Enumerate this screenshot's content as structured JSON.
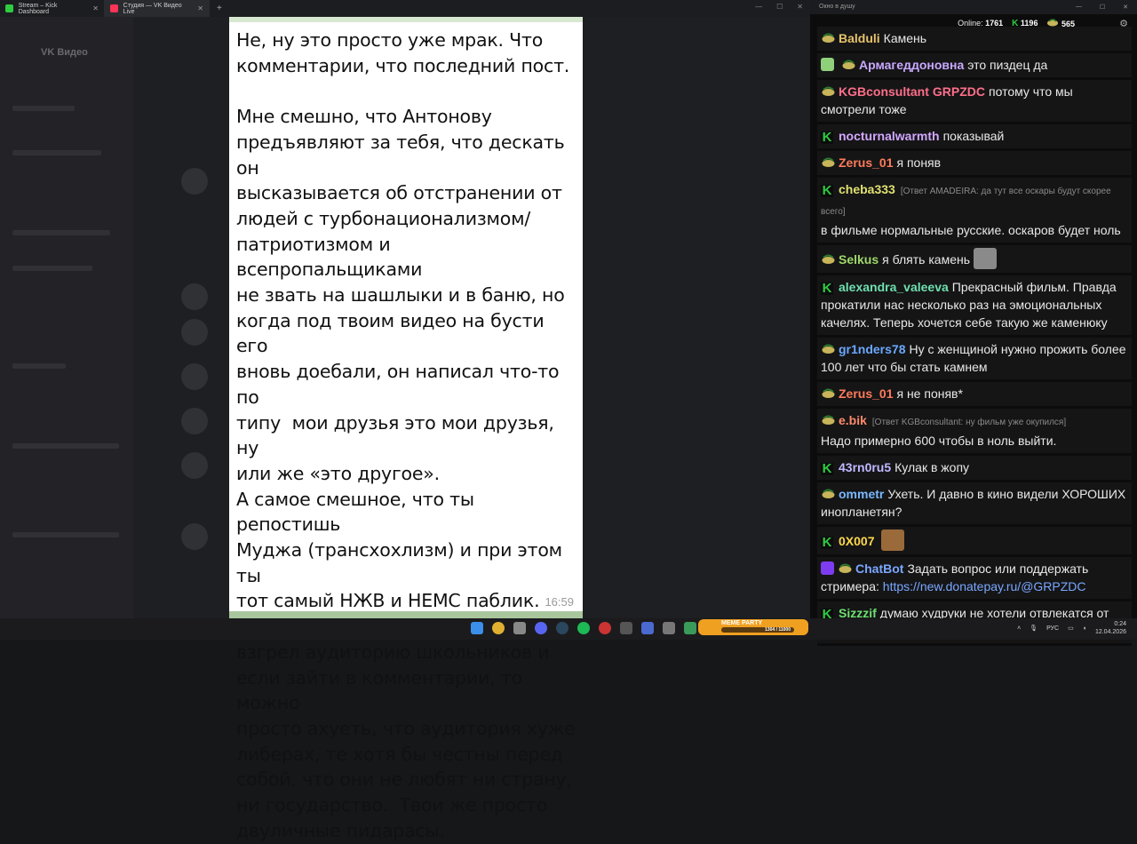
{
  "browser": {
    "tabs": [
      {
        "label": "Stream – Kick Dashboard",
        "color": "#2ecc40"
      },
      {
        "label": "Студия — VK Видео Live",
        "color": "#ff3355"
      }
    ],
    "new_tab": "+"
  },
  "background_app": {
    "title": "VK Видео"
  },
  "document": {
    "text": "Не, ну это просто уже мрак. Что\nкомментарии, что последний пост.\n\nМне смешно, что Антонову\nпредъявляют за тебя, что дескать он\nвысказывается об отстранении от\nлюдей с турбонационализмом/\nпатриотизмом и всепропальщиками\nне звать на шашлыки и в баню, но\nкогда под твоим видео на бусти его\nвновь доебали, он написал что-то по\nтипу  мои друзья это мои друзья, ну\nили же «это другое».\nА самое смешное, что ты репостишь\nМуджа (трансхохлизм) и при этом ты\nтот самый НЖВ и НЕМС паблик.  Ты\nвзгрел аудиторию школьников и\nесли зайти в комментарии, то можно\nпросто ахуеть, что аудитория хуже\nлиберах, те хотя бы честны перед\nсобой, что они не любят ни страну,\nни государство.  Твои же просто\nдвуличные пидарасы.",
    "time": "16:59"
  },
  "chat_window": {
    "title": "Окно в душу",
    "online_label": "Online:",
    "online_count": "1761",
    "kick_count": "1196",
    "vk_count": "565",
    "messages": [
      {
        "badge": "chip",
        "name": "Balduli",
        "color": "#e6c36a",
        "text": "Камень"
      },
      {
        "badge": "shield",
        "name": "Армагеддоновна",
        "color": "#c9a8ff",
        "text": "это пиздец да"
      },
      {
        "badge": "chip",
        "name": "KGBconsultant",
        "color": "#ff6f8a",
        "mention": "GRPZDC",
        "text": "потому что мы смотрели тоже"
      },
      {
        "badge": "k",
        "name": "nocturnalwarmth",
        "color": "#d2a8ff",
        "text": "показывай"
      },
      {
        "badge": "chip",
        "name": "Zerus_01",
        "color": "#ff7b5a",
        "text": "я поняв"
      },
      {
        "badge": "k",
        "name": "cheba333",
        "color": "#e0e070",
        "reply": "[Ответ AMADEIRA: да тут все оскары будут скорее всего]",
        "text": "в фильме нормальные русские. оскаров будет ноль"
      },
      {
        "badge": "chip",
        "name": "Selkus",
        "color": "#9fd86a",
        "text": "я блять камень",
        "emote": true
      },
      {
        "badge": "k",
        "name": "alexandra_valeeva",
        "color": "#6ee0b0",
        "text": "Прекрасный фильм. Правда прокатили нас несколько раз на эмоциональных качелях. Теперь хочется себе такую же каменюку"
      },
      {
        "badge": "chip",
        "name": "gr1nders78",
        "color": "#6aa8ff",
        "text": "Ну с женщиной нужно прожить более 100 лет что бы стать камнем"
      },
      {
        "badge": "chip",
        "name": "Zerus_01",
        "color": "#ff7b5a",
        "text": "я не поняв*"
      },
      {
        "badge": "chip",
        "name": "e.bik",
        "color": "#ff8a6a",
        "reply": "[Ответ KGBconsultant: ну фильм уже окупился]",
        "text": "Надо примерно 600 чтобы в ноль выйти."
      },
      {
        "badge": "k",
        "name": "43rn0ru5",
        "color": "#c0b8ff",
        "text": "Кулак в жопу"
      },
      {
        "badge": "chip",
        "name": "ommetr",
        "color": "#7ab8ff",
        "text": "Ухеть. И давно в кино видели ХОРОШИХ инопланетян?"
      },
      {
        "badge": "k",
        "name": "0X007",
        "color": "#ffd84a",
        "text": "",
        "emote": true
      },
      {
        "badge": "bot",
        "name": "ChatBot",
        "color": "#7aa7ff",
        "text": "Задать вопрос или поддержать стримера:",
        "link": "https://new.donatepay.ru/@GRPZDC"
      },
      {
        "badge": "k",
        "name": "Sizzzif",
        "color": "#6ee070",
        "text": "думаю худруки не хотели отвлекатся от фильма"
      }
    ]
  },
  "taskbar": {
    "meme_party": "MEME PARTY",
    "meme_progress": "1304 / 11000",
    "language": "РУС",
    "time": "0:24",
    "date": "12.04.2026"
  }
}
